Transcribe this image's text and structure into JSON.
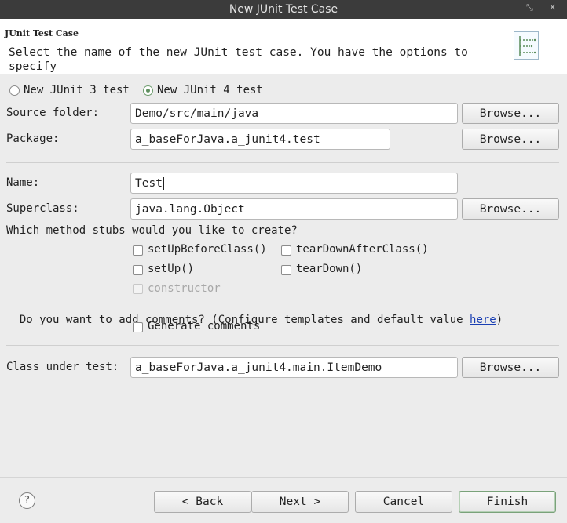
{
  "window": {
    "title": "New JUnit Test Case",
    "restore_glyph": "⤡",
    "close_glyph": "✕"
  },
  "header": {
    "title": "JUnit Test Case",
    "description": "Select the name of the new JUnit test case. You have the options to specify",
    "icon": "junit-wizard-icon"
  },
  "version": {
    "junit3_label": "New JUnit 3 test",
    "junit4_label": "New JUnit 4 test",
    "selected": "junit4"
  },
  "source_folder": {
    "label": "Source folder:",
    "value": "Demo/src/main/java",
    "browse_label": "Browse..."
  },
  "package": {
    "label": "Package:",
    "value": "a_baseForJava.a_junit4.test",
    "browse_label": "Browse..."
  },
  "name": {
    "label": "Name:",
    "value": "Test"
  },
  "superclass": {
    "label": "Superclass:",
    "value": "java.lang.Object",
    "browse_label": "Browse..."
  },
  "stubs": {
    "question": "Which method stubs would you like to create?",
    "setUpBeforeClass": "setUpBeforeClass()",
    "tearDownAfterClass": "tearDownAfterClass()",
    "setUp": "setUp()",
    "tearDown": "tearDown()",
    "constructor": "constructor"
  },
  "comments": {
    "question_prefix": "Do you want to add comments? (Configure templates and default value ",
    "link": "here",
    "question_suffix": ")",
    "generate_label": "Generate comments"
  },
  "class_under_test": {
    "label": "Class under test:",
    "value": "a_baseForJava.a_junit4.main.ItemDemo",
    "browse_label": "Browse..."
  },
  "footer": {
    "help_glyph": "?",
    "back_label": "< Back",
    "next_label": "Next >",
    "cancel_label": "Cancel",
    "finish_label": "Finish"
  }
}
